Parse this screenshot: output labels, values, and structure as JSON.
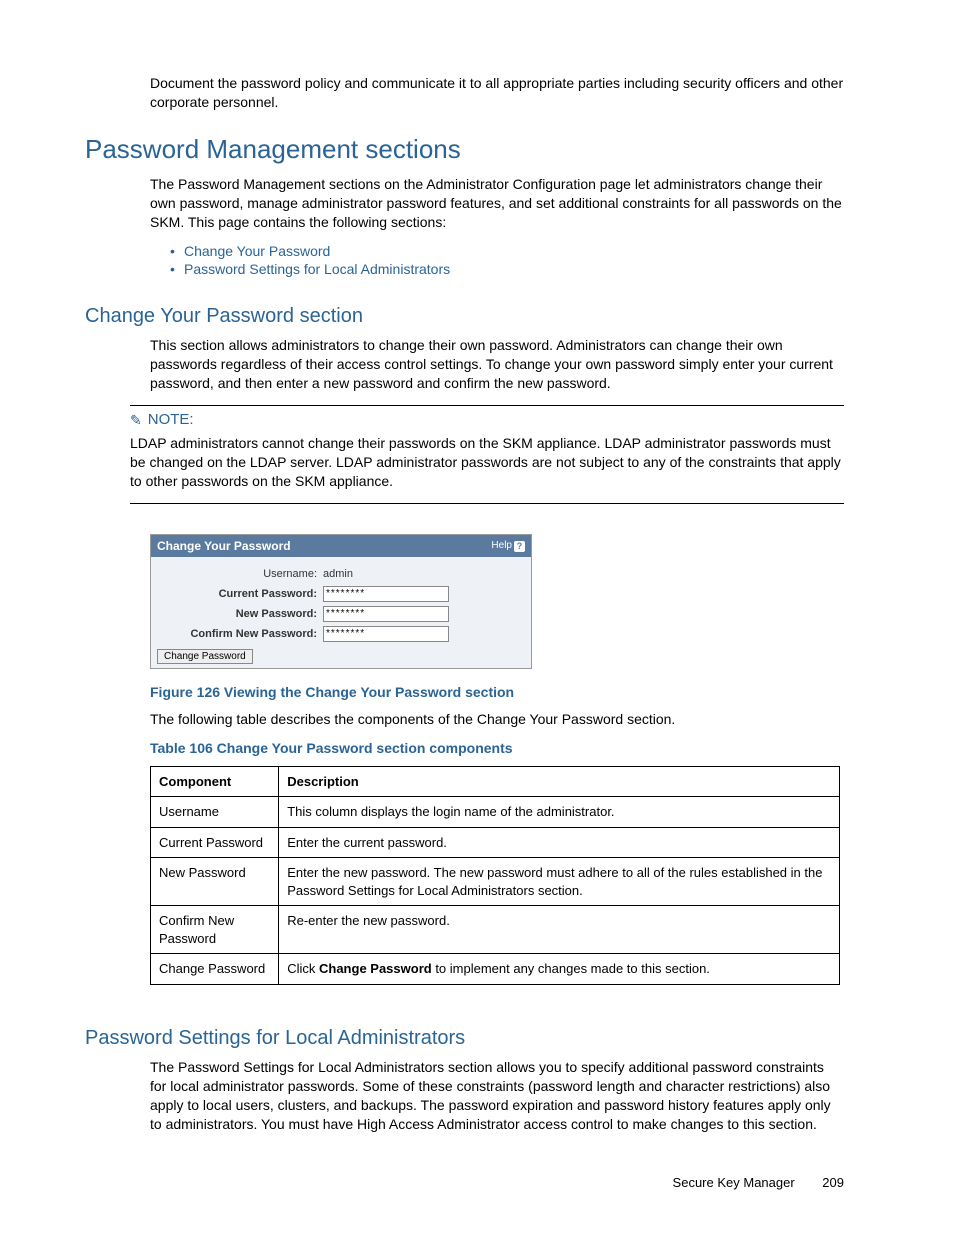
{
  "intro_paragraph": "Document the password policy and communicate it to all appropriate parties including security officers and other corporate personnel.",
  "h1": "Password Management sections",
  "h1_para": "The Password Management sections on the Administrator Configuration page let administrators change their own password, manage administrator password features, and set additional constraints for all passwords on the SKM. This page contains the following sections:",
  "links": [
    "Change Your Password",
    "Password Settings for Local Administrators"
  ],
  "h2a": "Change Your Password section",
  "h2a_para": "This section allows administrators to change their own password. Administrators can change their own passwords regardless of their access control settings. To change your own password simply enter your current password, and then enter a new password and confirm the new password.",
  "note_label": "NOTE:",
  "note_text": "LDAP administrators cannot change their passwords on the SKM appliance. LDAP administrator passwords must be changed on the LDAP server. LDAP administrator passwords are not subject to any of the constraints that apply to other passwords on the SKM appliance.",
  "panel": {
    "title": "Change Your Password",
    "help": "Help",
    "rows": {
      "username_label": "Username:",
      "username_value": "admin",
      "current_label": "Current Password:",
      "new_label": "New Password:",
      "confirm_label": "Confirm New Password:",
      "masked": "********"
    },
    "button": "Change Password"
  },
  "figure_caption": "Figure 126 Viewing the Change Your Password section",
  "caption_following": "The following table describes the components of the Change Your Password section.",
  "table_caption": "Table 106 Change Your Password section components",
  "table": {
    "headers": [
      "Component",
      "Description"
    ],
    "rows": [
      [
        "Username",
        "This column displays the login name of the administrator."
      ],
      [
        "Current Password",
        "Enter the current password."
      ],
      [
        "New Password",
        "Enter the new password. The new password must adhere to all of the rules established in the Password Settings for Local Administrators section."
      ],
      [
        "Confirm New Password",
        "Re-enter the new password."
      ],
      [
        "Change Password",
        "Click Change Password to implement any changes made to this section."
      ]
    ],
    "bold_in_last": "Change Password"
  },
  "h2b": "Password Settings for Local Administrators",
  "h2b_para": "The Password Settings for Local Administrators section allows you to specify additional password constraints for local administrator passwords. Some of these constraints (password length and character restrictions) also apply to local users, clusters, and backups. The password expiration and password history features apply only to administrators. You must have High Access Administrator access control to make changes to this section.",
  "footer": {
    "doc": "Secure Key Manager",
    "page": "209"
  }
}
